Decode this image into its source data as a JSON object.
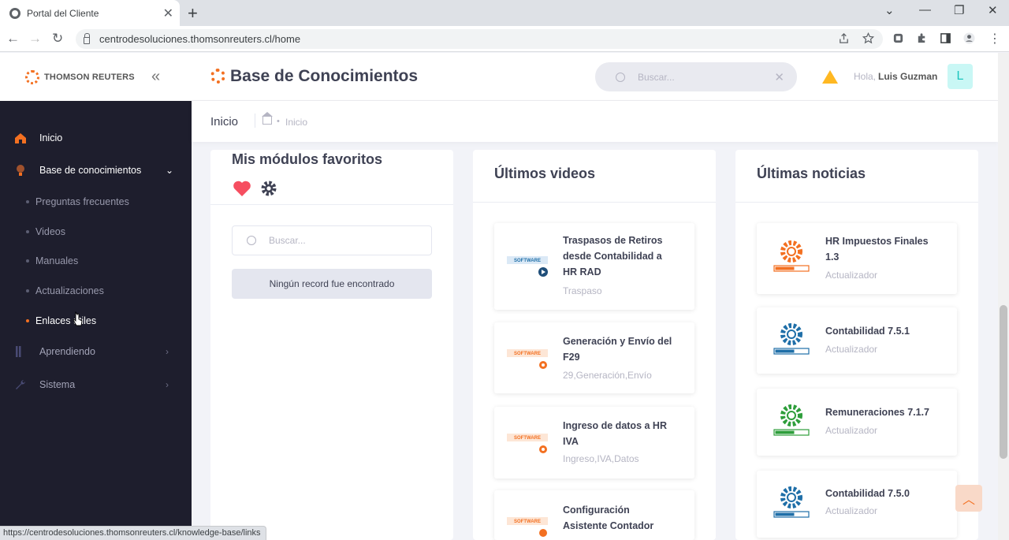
{
  "browser": {
    "tab_title": "Portal del Cliente",
    "url": "centrodesoluciones.thomsonreuters.cl/home",
    "status_url": "https://centrodesoluciones.thomsonreuters.cl/knowledge-base/links"
  },
  "brand": {
    "logo_text": "THOMSON REUTERS",
    "accent": "#f37021"
  },
  "header": {
    "title": "Base de Conocimientos",
    "search_placeholder": "Buscar...",
    "greeting": "Hola,",
    "user_name": "Luis Guzman",
    "avatar_initial": "L"
  },
  "sidebar": {
    "items": [
      {
        "label": "Inicio",
        "icon": "home-icon"
      },
      {
        "label": "Base de conocimientos",
        "icon": "bulb-icon"
      },
      {
        "label": "Aprendiendo",
        "icon": "bars-icon"
      },
      {
        "label": "Sistema",
        "icon": "wrench-icon"
      }
    ],
    "subitems": [
      {
        "label": "Preguntas frecuentes"
      },
      {
        "label": "Videos"
      },
      {
        "label": "Manuales"
      },
      {
        "label": "Actualizaciones"
      },
      {
        "label": "Enlaces útiles"
      }
    ]
  },
  "subheader": {
    "title": "Inicio",
    "crumb": "Inicio"
  },
  "favorites": {
    "title": "Mis módulos favoritos",
    "search_placeholder": "Buscar...",
    "empty_message": "Ningún record fue encontrado"
  },
  "videos": {
    "title": "Últimos videos",
    "items": [
      {
        "title_line1": "Traspasos de Retiros",
        "title_line2": "desde Contabilidad a",
        "title_line3": "HR RAD",
        "tags": "Traspaso"
      },
      {
        "title_line1": "Generación y Envío del",
        "title_line2": "F29",
        "tags": "29,Generación,Envío"
      },
      {
        "title_line1": "Ingreso de datos a HR",
        "title_line2": "IVA",
        "tags": "Ingreso,IVA,Datos"
      },
      {
        "title_line1": "Configuración",
        "title_line2": "Asistente Contador"
      }
    ]
  },
  "news": {
    "title": "Últimas noticias",
    "items": [
      {
        "title_line1": "HR Impuestos Finales",
        "title_line2": "1.3",
        "tag": "Actualizador",
        "color": "#f37021"
      },
      {
        "title_line1": "Contabilidad 7.5.1",
        "tag": "Actualizador",
        "color": "#1f6fa8"
      },
      {
        "title_line1": "Remuneraciones 7.1.7",
        "tag": "Actualizador",
        "color": "#2e9e3b"
      },
      {
        "title_line1": "Contabilidad 7.5.0",
        "tag": "Actualizador",
        "color": "#1f6fa8"
      }
    ]
  }
}
